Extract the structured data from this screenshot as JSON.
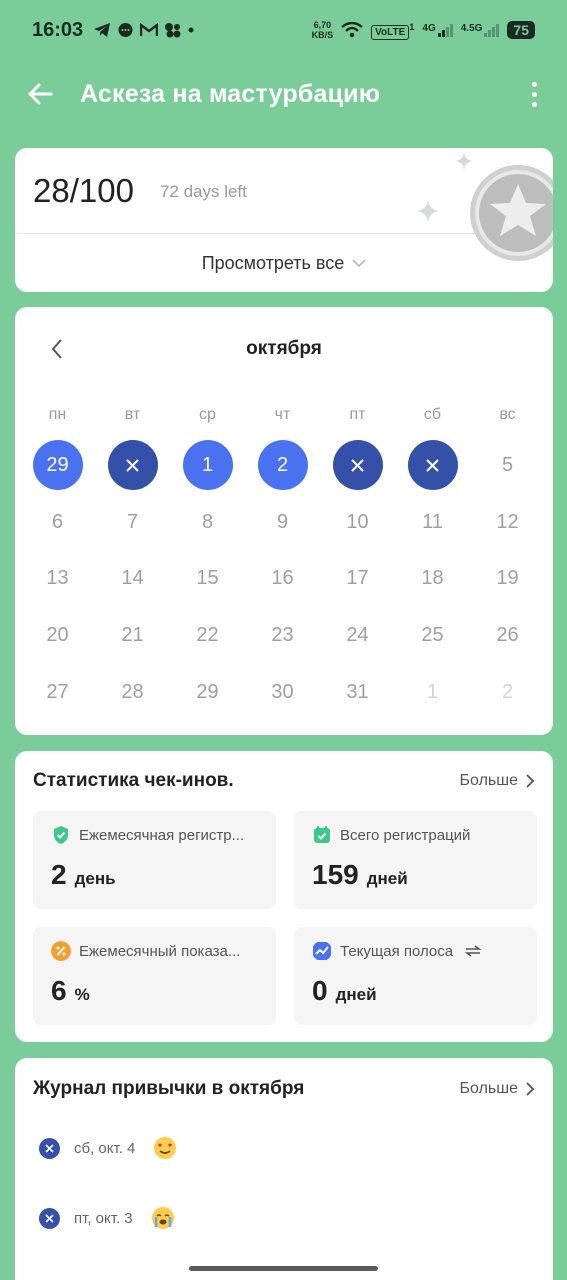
{
  "status_bar": {
    "time": "16:03",
    "net_speed_value": "6,70",
    "net_speed_unit": "KB/S",
    "volte": "VoLTE",
    "volte_sub": "1",
    "net1": "4G",
    "net2": "4.5G",
    "battery": "75"
  },
  "app_bar": {
    "title": "Аскеза на мастурбацию"
  },
  "progress": {
    "count": "28/100",
    "days_left": "72 days left",
    "view_all": "Просмотреть все"
  },
  "calendar": {
    "month": "октября",
    "weekdays": [
      "пн",
      "вт",
      "ср",
      "чт",
      "пт",
      "сб",
      "вс"
    ],
    "days": [
      {
        "label": "29",
        "state": "done"
      },
      {
        "label": "",
        "state": "fail"
      },
      {
        "label": "1",
        "state": "done"
      },
      {
        "label": "2",
        "state": "done"
      },
      {
        "label": "",
        "state": "fail"
      },
      {
        "label": "",
        "state": "fail"
      },
      {
        "label": "5",
        "state": "none"
      },
      {
        "label": "6",
        "state": "none"
      },
      {
        "label": "7",
        "state": "none"
      },
      {
        "label": "8",
        "state": "none"
      },
      {
        "label": "9",
        "state": "none"
      },
      {
        "label": "10",
        "state": "none"
      },
      {
        "label": "11",
        "state": "none"
      },
      {
        "label": "12",
        "state": "none"
      },
      {
        "label": "13",
        "state": "none"
      },
      {
        "label": "14",
        "state": "none"
      },
      {
        "label": "15",
        "state": "none"
      },
      {
        "label": "16",
        "state": "none"
      },
      {
        "label": "17",
        "state": "none"
      },
      {
        "label": "18",
        "state": "none"
      },
      {
        "label": "19",
        "state": "none"
      },
      {
        "label": "20",
        "state": "none"
      },
      {
        "label": "21",
        "state": "none"
      },
      {
        "label": "22",
        "state": "none"
      },
      {
        "label": "23",
        "state": "none"
      },
      {
        "label": "24",
        "state": "none"
      },
      {
        "label": "25",
        "state": "none"
      },
      {
        "label": "26",
        "state": "none"
      },
      {
        "label": "27",
        "state": "none"
      },
      {
        "label": "28",
        "state": "none"
      },
      {
        "label": "29",
        "state": "none"
      },
      {
        "label": "30",
        "state": "none"
      },
      {
        "label": "31",
        "state": "none"
      },
      {
        "label": "1",
        "state": "dim"
      },
      {
        "label": "2",
        "state": "dim"
      }
    ]
  },
  "stats": {
    "title": "Статистика чек-инов.",
    "more": "Больше",
    "items": [
      {
        "label": "Ежемесячная регистр...",
        "value": "2",
        "unit": "день",
        "icon": "check-shield-icon",
        "color": "#3ec98a"
      },
      {
        "label": "Всего регистраций",
        "value": "159",
        "unit": "дней",
        "icon": "calendar-check-icon",
        "color": "#3ec98a"
      },
      {
        "label": "Ежемесячный показа...",
        "value": "6",
        "unit": "%",
        "icon": "percent-icon",
        "color": "#f0a030"
      },
      {
        "label": "Текущая полоса",
        "value": "0",
        "unit": "дней",
        "icon": "trend-icon",
        "color": "#4a72f0"
      }
    ]
  },
  "journal": {
    "title": "Журнал привычки в октября",
    "more": "Больше",
    "entries": [
      {
        "date": "сб, окт. 4",
        "emoji": "heart-eyes-emoji"
      },
      {
        "date": "пт, окт. 3",
        "emoji": "crying-emoji"
      }
    ]
  },
  "colors": {
    "background": "#7acc98",
    "done": "#4a72f0",
    "fail": "#3550a8"
  }
}
